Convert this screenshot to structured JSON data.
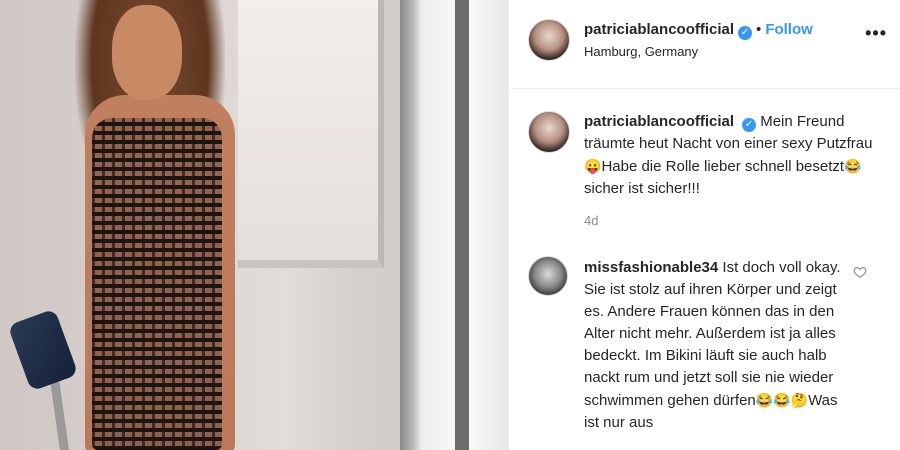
{
  "post": {
    "username": "patriciablancoofficial",
    "follow_label": "Follow",
    "location": "Hamburg, Germany",
    "more_label": "•••"
  },
  "caption": {
    "username": "patriciablancoofficial",
    "text_part1": "Mein Freund träumte heut Nacht von einer sexy Putzfrau",
    "emoji1": "😛",
    "text_part2": "Habe die Rolle lieber schnell besetzt",
    "emoji2": "😂",
    "text_part3": "sicher ist sicher!!!",
    "time": "4d"
  },
  "comment": {
    "username": "missfashionable34",
    "text_part1": "Ist doch voll okay. Sie ist stolz auf ihren Körper und zeigt es. Andere Frauen können das in den Alter nicht mehr. Außerdem ist ja alles bedeckt. Im Bikini läuft sie auch halb nackt rum und jetzt soll sie nie wieder schwimmen gehen dürfen",
    "emojis": "😂😂🤔",
    "text_part2": "Was ist nur aus"
  },
  "colors": {
    "accent": "#3897f0",
    "text": "#262626",
    "muted": "#8e8e8e",
    "border": "#efefef"
  },
  "icons": [
    "verified-badge-icon",
    "more-options-icon",
    "heart-icon"
  ]
}
